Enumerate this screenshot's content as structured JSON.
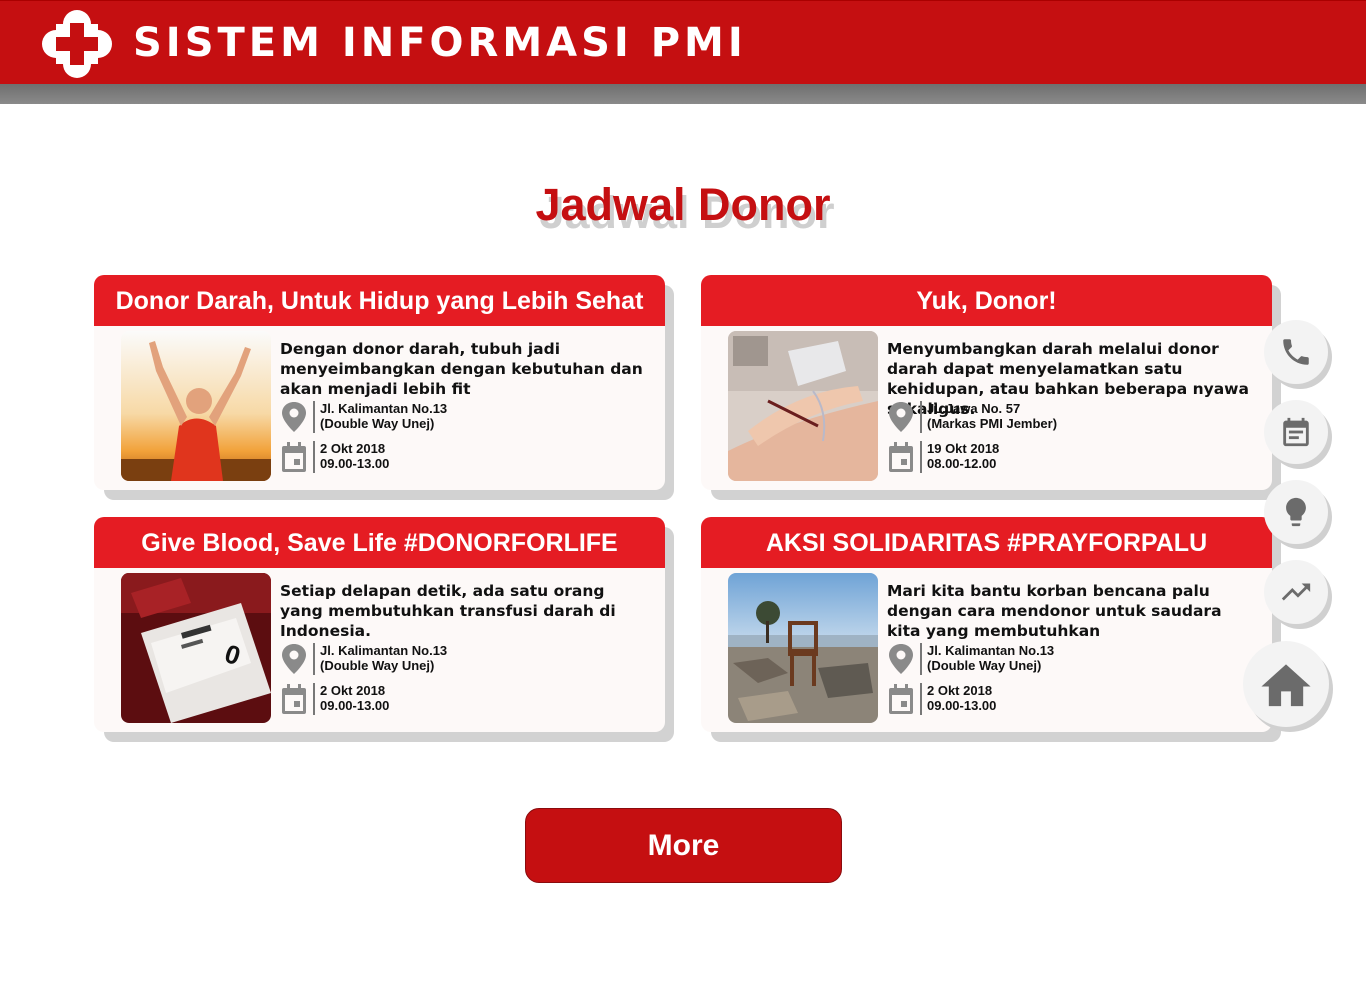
{
  "header": {
    "title": "SISTEM INFORMASI PMI"
  },
  "section": {
    "title": "Jadwal Donor"
  },
  "cards": [
    {
      "title": "Donor Darah, Untuk Hidup yang Lebih Sehat",
      "description": "Dengan donor darah, tubuh jadi menyeimbangkan dengan kebutuhan dan akan menjadi lebih fit",
      "address_line1": "Jl. Kalimantan No.13",
      "address_line2": "(Double Way Unej)",
      "date": "2 Okt 2018",
      "time": "09.00-13.00"
    },
    {
      "title": "Yuk, Donor!",
      "description": "Menyumbangkan darah melalui donor darah dapat menyelamatkan satu kehidupan, atau bahkan beberapa nyawa sekaligus.",
      "address_line1": "JL.Jawa No. 57",
      "address_line2": "(Markas PMI Jember)",
      "date": "19 Okt 2018",
      "time": "08.00-12.00"
    },
    {
      "title": "Give Blood, Save Life #DONORFORLIFE",
      "description": "Setiap delapan detik, ada satu orang yang membutuhkan transfusi darah di Indonesia.",
      "address_line1": "Jl. Kalimantan No.13",
      "address_line2": "(Double Way Unej)",
      "date": "2 Okt 2018",
      "time": "09.00-13.00"
    },
    {
      "title": "AKSI SOLIDARITAS #PRAYFORPALU",
      "description": "Mari kita bantu korban bencana palu dengan cara mendonor untuk saudara kita yang membutuhkan",
      "address_line1": "Jl. Kalimantan No.13",
      "address_line2": "(Double Way Unej)",
      "date": "2 Okt 2018",
      "time": "09.00-13.00"
    }
  ],
  "actions": {
    "more_label": "More"
  },
  "side_menu": [
    "phone-icon",
    "schedule-icon",
    "lightbulb-icon",
    "trending-icon",
    "home-icon"
  ],
  "colors": {
    "primary": "#c50f11",
    "card_header": "#e51c23",
    "card_bg": "#fdf9f8"
  }
}
